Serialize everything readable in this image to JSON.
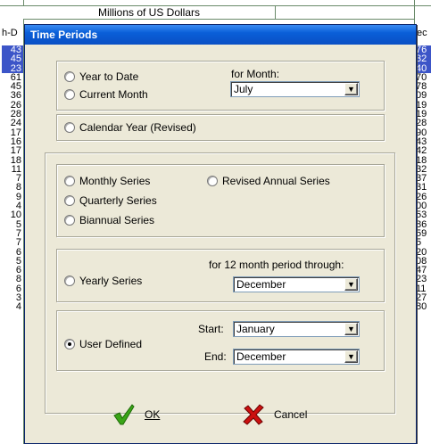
{
  "spreadsheet": {
    "header_label": "Millions of US Dollars",
    "left_header": "h-D",
    "right_header": "ec",
    "left_col": [
      "43",
      "45",
      "23",
      "61",
      "45",
      "36",
      "26",
      "28",
      "24",
      "17",
      "16",
      "17",
      "18",
      "11",
      "7",
      "8",
      "9",
      "4",
      "10",
      "5",
      "7",
      "7",
      "6",
      "5",
      "6",
      "8",
      "6",
      "3",
      "4"
    ],
    "right_col": [
      "76",
      "32",
      "40",
      "70",
      "78",
      "09",
      "19",
      "19",
      "28",
      "90",
      "43",
      "42",
      "18",
      "32",
      "37",
      "31",
      "26",
      "00",
      "53",
      "86",
      "59",
      "5",
      "20",
      "08",
      "47",
      "23",
      "11",
      "27",
      "80"
    ]
  },
  "dialog": {
    "title": "Time Periods",
    "period": {
      "year_to_date_label": "Year to Date",
      "current_month_label": "Current Month",
      "for_month_label": "for Month:",
      "for_month_value": "July"
    },
    "calendar_year_label": "Calendar Year  (Revised)",
    "series": {
      "monthly_label": "Monthly Series",
      "quarterly_label": "Quarterly Series",
      "biannual_label": "Biannual Series",
      "revised_annual_label": "Revised Annual Series"
    },
    "yearly": {
      "label": "Yearly Series",
      "through_label": "for 12 month period through:",
      "through_value": "December"
    },
    "user_defined": {
      "label": "User Defined",
      "start_label": "Start:",
      "start_value": "January",
      "end_label": "End:",
      "end_value": "December"
    },
    "ok_label": "OK",
    "cancel_label": "Cancel",
    "ok_icon": "checkmark-icon",
    "cancel_icon": "x-icon",
    "colors": {
      "title_bar": "#0a5fd8",
      "selected_cells": "#3c55c8",
      "ok_icon": "#3aa517",
      "cancel_icon": "#cc1010",
      "dialog_bg": "#ece9d8"
    }
  }
}
